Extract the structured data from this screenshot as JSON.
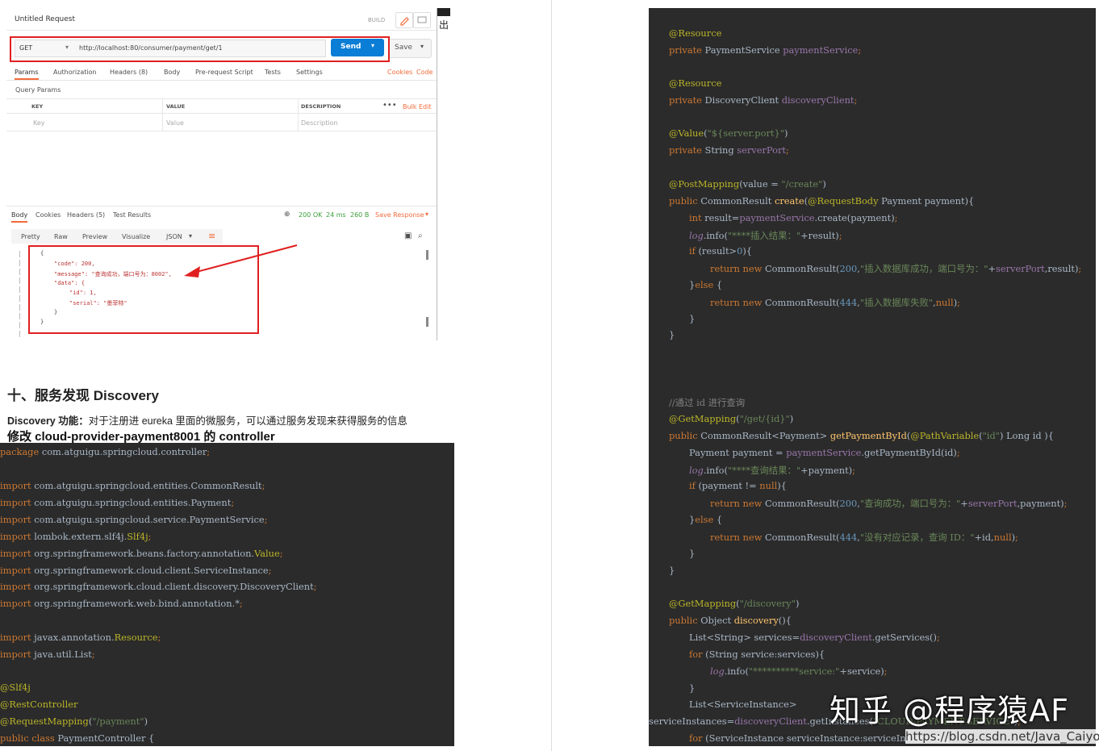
{
  "postman": {
    "title": "Untitled Request",
    "build": "BUILD",
    "method": "GET",
    "url": "http://localhost:80/consumer/payment/get/1",
    "send": "Send",
    "save": "Save",
    "tabs": [
      "Params",
      "Authorization",
      "Headers (8)",
      "Body",
      "Pre-request Script",
      "Tests",
      "Settings"
    ],
    "cookies": "Cookies",
    "code": "Code",
    "query_params": "Query Params",
    "col_key": "KEY",
    "col_value": "VALUE",
    "col_desc": "DESCRIPTION",
    "bulk_edit": "Bulk Edit",
    "ph_key": "Key",
    "ph_value": "Value",
    "ph_desc": "Description",
    "resp_tabs": [
      "Body",
      "Cookies",
      "Headers (5)",
      "Test Results"
    ],
    "status": "200 OK",
    "time": "24 ms",
    "size": "260 B",
    "save_response": "Save Response",
    "view_tabs": [
      "Pretty",
      "Raw",
      "Preview",
      "Visualize"
    ],
    "format": "JSON",
    "json_lines": [
      "{",
      "\"code\": 200,",
      "\"message\": \"查询成功，端口号为：8002\",",
      "\"data\": {",
      "\"id\": 1,",
      "\"serial\": \"墨菲特\"",
      "}",
      "}"
    ],
    "side_text": "出"
  },
  "section_heading": "十、服务发现 Discovery",
  "paragraph_bold": "Discovery 功能：",
  "paragraph_rest": "对于注册进 eureka 里面的微服务，可以通过服务发现来获得服务的信息",
  "subheading": "修改 cloud-provider-payment8001 的 controller",
  "watermark_main": "知乎 @程序猿AF",
  "watermark_url": "https://blog.csdn.net/Java_Caiyo",
  "colors": {
    "code_bg": "#2b2b2b",
    "keyword": "#cc7832",
    "annotation": "#bbb529",
    "string": "#6a8759",
    "field": "#9876aa",
    "send_button": "#0a7dd6",
    "highlight_box": "#e02020"
  }
}
